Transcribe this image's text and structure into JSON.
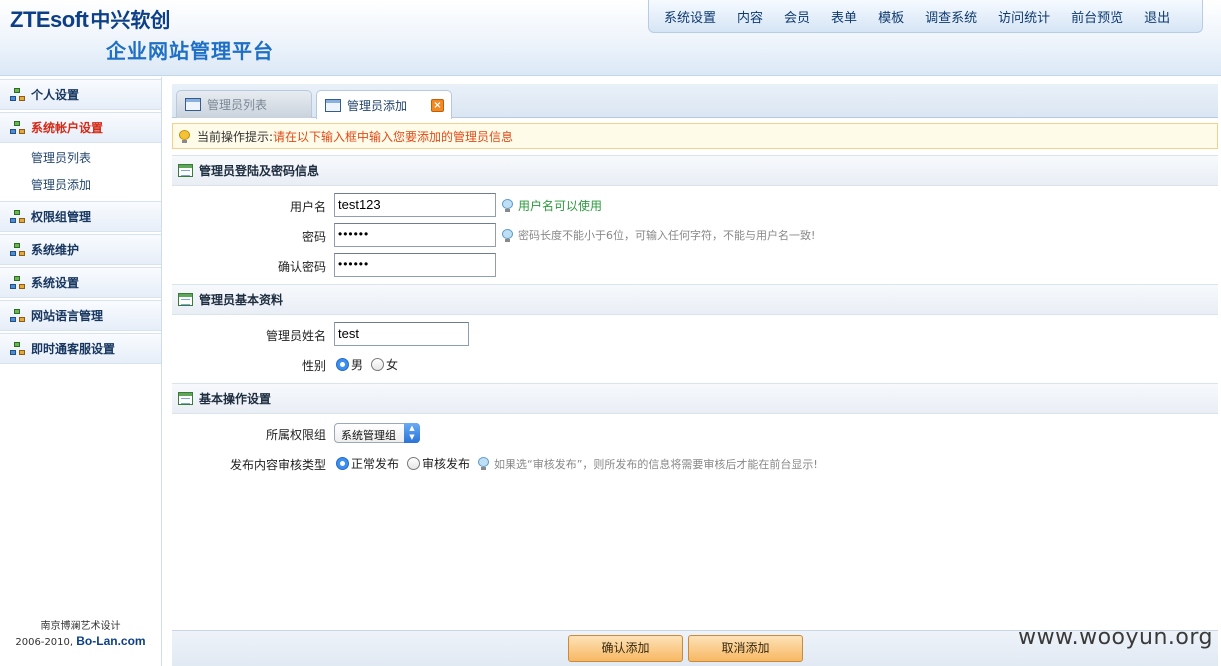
{
  "header": {
    "brand": "ZTEsoft",
    "brand_cn": "中兴软创",
    "platform_title": "企业网站管理平台",
    "nav": [
      "系统设置",
      "内容",
      "会员",
      "表单",
      "模板",
      "调查系统",
      "访问统计",
      "前台预览",
      "退出"
    ]
  },
  "sidebar": {
    "items": [
      {
        "label": "个人设置"
      },
      {
        "label": "系统帐户设置",
        "active": true,
        "children": [
          "管理员列表",
          "管理员添加"
        ]
      },
      {
        "label": "权限组管理"
      },
      {
        "label": "系统维护"
      },
      {
        "label": "系统设置"
      },
      {
        "label": "网站语言管理"
      },
      {
        "label": "即时通客服设置"
      }
    ],
    "footer_line1": "南京博澜艺术设计",
    "footer_year": "2006-2010,",
    "footer_site": "Bo-Lan.com"
  },
  "tabs": [
    "管理员列表",
    "管理员添加"
  ],
  "tip": {
    "label": "当前操作提示:",
    "text": "请在以下输入框中输入您要添加的管理员信息"
  },
  "sections": {
    "login": "管理员登陆及密码信息",
    "basic": "管理员基本资料",
    "ops": "基本操作设置"
  },
  "form": {
    "username_label": "用户名",
    "username_value": "test123",
    "username_hint": "用户名可以使用",
    "password_label": "密码",
    "password_value": "••••••",
    "password_hint": "密码长度不能小于6位，可输入任何字符，不能与用户名一致!",
    "confirm_label": "确认密码",
    "confirm_value": "••••••",
    "name_label": "管理员姓名",
    "name_value": "test",
    "gender_label": "性别",
    "gender_options": [
      "男",
      "女"
    ],
    "gender_selected": "男",
    "group_label": "所属权限组",
    "group_value": "系统管理组",
    "review_label": "发布内容审核类型",
    "review_options": [
      "正常发布",
      "审核发布"
    ],
    "review_selected": "正常发布",
    "review_hint": "如果选“审核发布”，则所发布的信息将需要审核后才能在前台显示!"
  },
  "buttons": {
    "confirm": "确认添加",
    "cancel": "取消添加"
  },
  "watermark": "www.wooyun.org",
  "colors": {
    "accent": "#1f6fc4",
    "active_menu": "#d42a17",
    "tip_text": "#e04b17",
    "ok_hint": "#2a9a3c",
    "button": "#f7b863"
  }
}
